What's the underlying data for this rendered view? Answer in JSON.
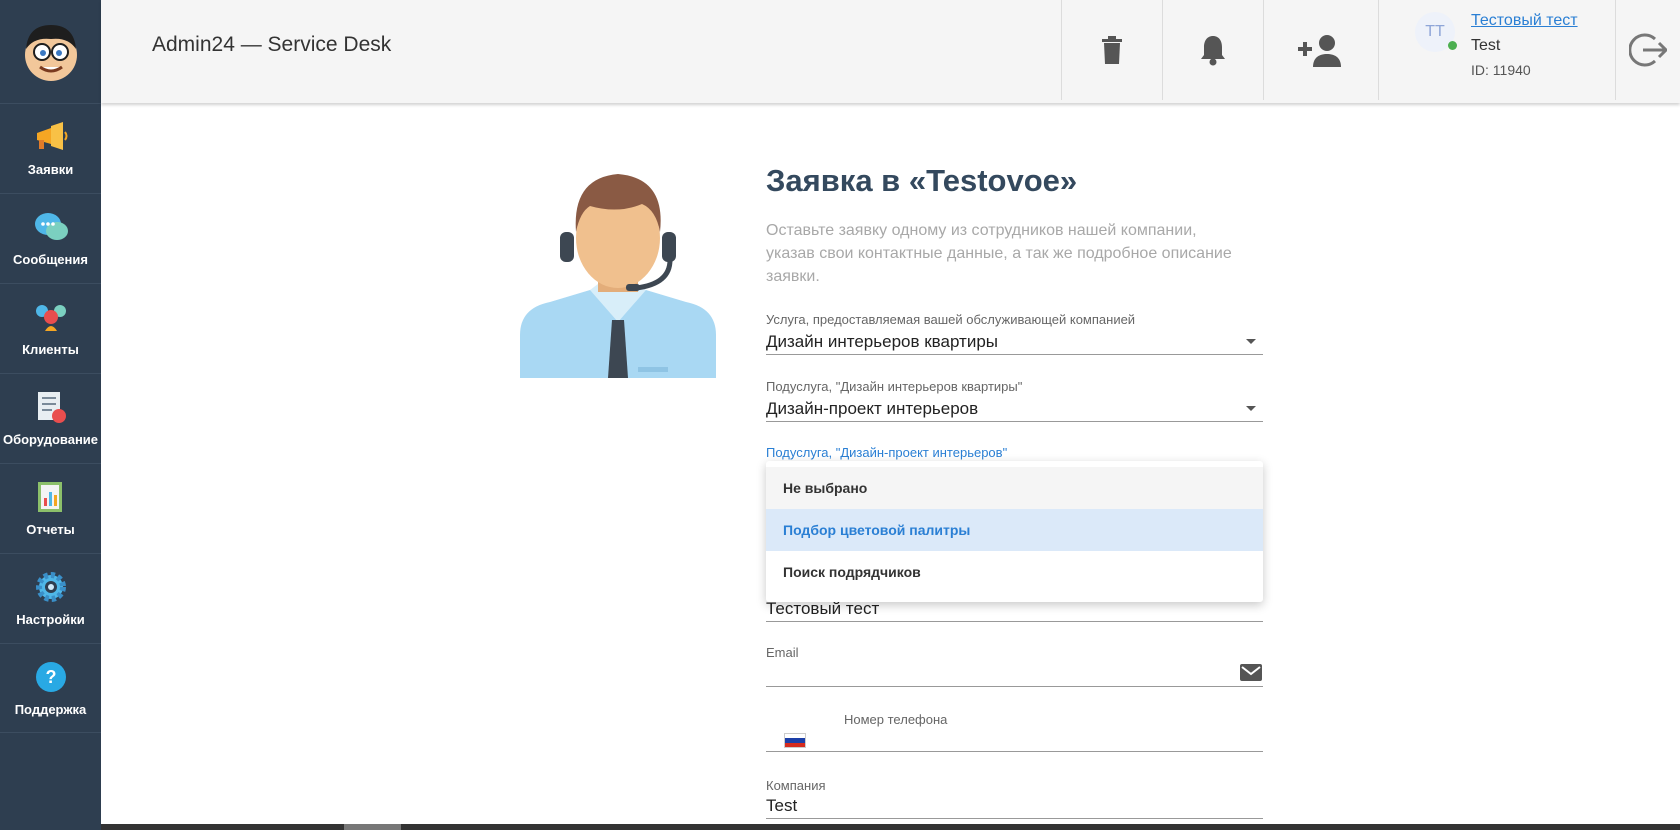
{
  "header": {
    "app_title": "Admin24 — Service Desk",
    "buttons": [
      {
        "icon": "trash-icon"
      },
      {
        "icon": "bell-icon"
      },
      {
        "icon": "add-user-icon"
      }
    ],
    "user": {
      "initials": "TT",
      "name": "Тестовый тест",
      "company": "Test",
      "id": "ID: 11940",
      "status": "online"
    },
    "logout_icon": "logout-icon"
  },
  "sidebar": {
    "items": [
      {
        "label": "Заявки",
        "icon": "megaphone-icon"
      },
      {
        "label": "Сообщения",
        "icon": "chat-bubbles-icon"
      },
      {
        "label": "Клиенты",
        "icon": "clients-icon"
      },
      {
        "label": "Оборудование",
        "icon": "checklist-icon"
      },
      {
        "label": "Отчеты",
        "icon": "report-chart-icon"
      },
      {
        "label": "Настройки",
        "icon": "gear-icon"
      },
      {
        "label": "Поддержка",
        "icon": "question-icon"
      }
    ]
  },
  "form": {
    "title": "Заявка в «Testovoe»",
    "description": "Оставьте заявку одному из сотрудников нашей компании, указав свои контактные данные, а так же подробное описание заявки.",
    "service": {
      "label": "Услуга, предоставляемая вашей обслуживающей компанией",
      "value": "Дизайн интерьеров квартиры"
    },
    "subservice": {
      "label": "Подуслуга, \"Дизайн интерьеров квартиры\"",
      "value": "Дизайн-проект интерьеров"
    },
    "subservice2": {
      "label": "Подуслуга, \"Дизайн-проект интерьеров\"",
      "options": [
        "Не выбрано",
        "Подбор цветовой палитры",
        "Поиск подрядчиков"
      ],
      "selected_index": 1
    },
    "name": {
      "value": "Тестовый тест"
    },
    "email": {
      "label": "Email"
    },
    "phone": {
      "label": "Номер телефона"
    },
    "company": {
      "label": "Компания",
      "value": "Test"
    }
  },
  "colors": {
    "sidebar_bg": "#2e3e50",
    "accent": "#2a7fd4",
    "title": "#34495e",
    "selected_option_bg": "#dbe9f9"
  }
}
